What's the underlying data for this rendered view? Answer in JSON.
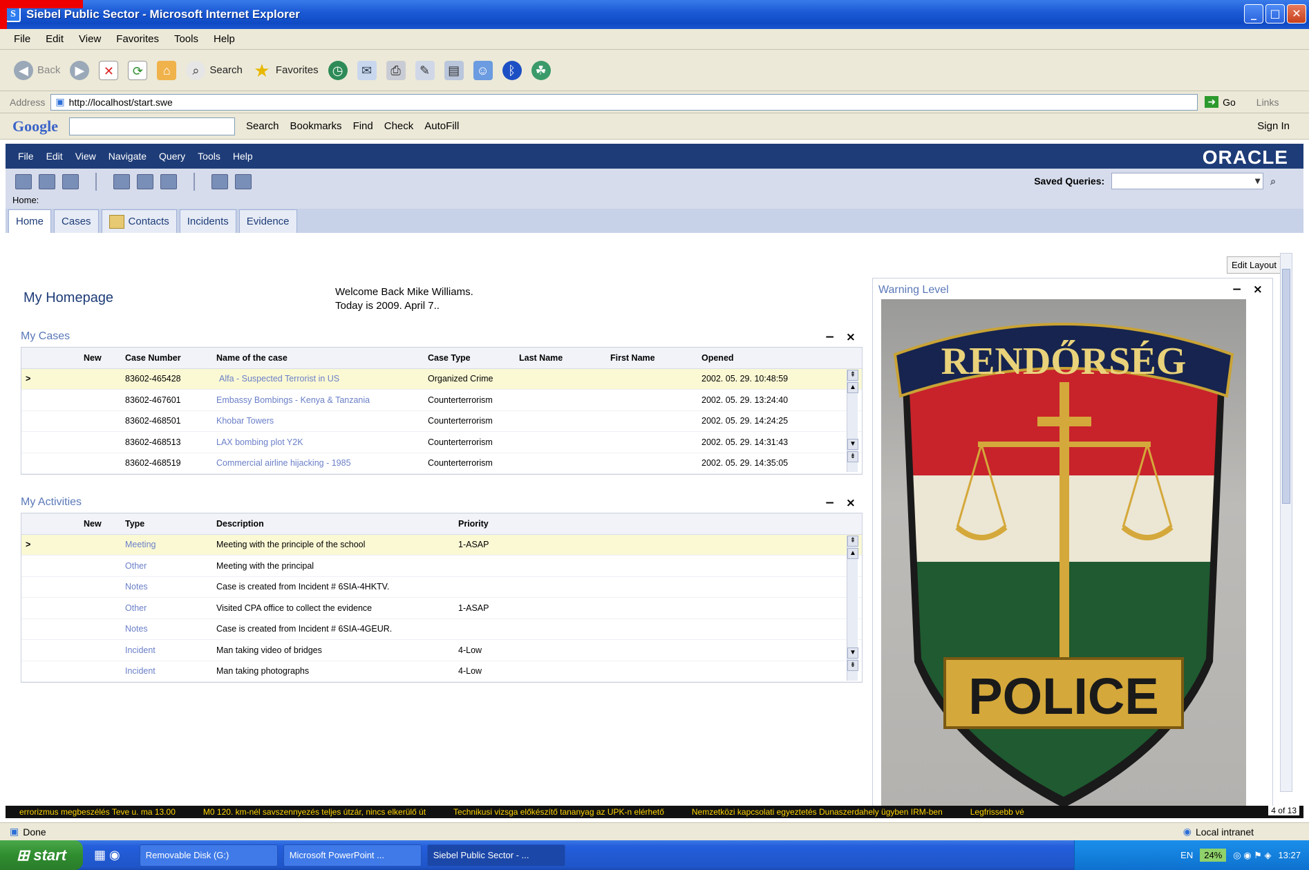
{
  "window": {
    "title": "Siebel Public Sector - Microsoft Internet Explorer"
  },
  "ie_menu": [
    "File",
    "Edit",
    "View",
    "Favorites",
    "Tools",
    "Help"
  ],
  "ie_toolbar": {
    "back": "Back",
    "search": "Search",
    "favorites": "Favorites"
  },
  "address": {
    "label": "Address",
    "url": "http://localhost/start.swe",
    "go": "Go",
    "links": "Links"
  },
  "google_bar": {
    "logo": "Google",
    "search": "Search",
    "bookmarks": "Bookmarks",
    "find": "Find",
    "check": "Check",
    "autofill": "AutoFill",
    "sign_in": "Sign In"
  },
  "siebel": {
    "menu": [
      "File",
      "Edit",
      "View",
      "Navigate",
      "Query",
      "Tools",
      "Help"
    ],
    "brand": "ORACLE",
    "saved_queries_label": "Saved Queries:",
    "breadcrumb": "Home:",
    "tabs": [
      "Home",
      "Cases",
      "Contacts",
      "Incidents",
      "Evidence"
    ]
  },
  "home": {
    "edit_layout": "Edit Layout",
    "title": "My Homepage",
    "welcome_line1": "Welcome Back Mike Williams.",
    "welcome_line2": "Today is 2009. April 7.."
  },
  "my_cases": {
    "title": "My Cases",
    "columns": [
      "New",
      "Case Number",
      "Name of the case",
      "Case Type",
      "Last Name",
      "First Name",
      "Opened"
    ],
    "rows": [
      {
        "num": "83602-465428",
        "name": "Alfa - Suspected Terrorist in US",
        "type": "Organized Crime",
        "opened": "2002. 05. 29. 10:48:59"
      },
      {
        "num": "83602-467601",
        "name": "Embassy Bombings - Kenya & Tanzania",
        "type": "Counterterrorism",
        "opened": "2002. 05. 29. 13:24:40"
      },
      {
        "num": "83602-468501",
        "name": "Khobar Towers",
        "type": "Counterterrorism",
        "opened": "2002. 05. 29. 14:24:25"
      },
      {
        "num": "83602-468513",
        "name": "LAX bombing plot Y2K",
        "type": "Counterterrorism",
        "opened": "2002. 05. 29. 14:31:43"
      },
      {
        "num": "83602-468519",
        "name": "Commercial airline hijacking - 1985",
        "type": "Counterterrorism",
        "opened": "2002. 05. 29. 14:35:05"
      }
    ]
  },
  "my_activities": {
    "title": "My Activities",
    "columns": [
      "New",
      "Type",
      "Description",
      "Priority"
    ],
    "rows": [
      {
        "type": "Meeting",
        "desc": "Meeting with the principle of the school",
        "priority": "1-ASAP"
      },
      {
        "type": "Other",
        "desc": "Meeting with the principal",
        "priority": ""
      },
      {
        "type": "Notes",
        "desc": "Case is created from Incident # 6SIA-4HKTV.",
        "priority": ""
      },
      {
        "type": "Other",
        "desc": "Visited CPA office to collect the evidence",
        "priority": "1-ASAP"
      },
      {
        "type": "Notes",
        "desc": "Case is created from Incident # 6SIA-4GEUR.",
        "priority": ""
      },
      {
        "type": "Incident",
        "desc": "Man taking video of bridges",
        "priority": "4-Low"
      },
      {
        "type": "Incident",
        "desc": "Man taking photographs",
        "priority": "4-Low"
      }
    ]
  },
  "warning": {
    "title": "Warning Level",
    "badge_top": "RENDŐRSÉG",
    "badge_bottom": "POLICE"
  },
  "ticker": {
    "items": [
      "errorizmus megbeszélés Teve u. ma 13.00",
      "M0 120. km-nél savszennyezés teljes útzár, nincs elkerülő út",
      "Technikusi vizsga előkészítő tananyag az UPK-n elérhető",
      "Nemzetközi kapcsolati egyeztetés Dunaszerdahely ügyben IRM-ben",
      "Legfrissebb vé"
    ],
    "count": "4 of 13"
  },
  "status": {
    "text": "Done",
    "zone": "Local intranet"
  },
  "taskbar": {
    "start": "start",
    "tasks": [
      "Removable Disk (G:)",
      "Microsoft PowerPoint ...",
      "Siebel Public Sector - ..."
    ],
    "lang": "EN",
    "battery": "24%",
    "clock": "13:27"
  }
}
